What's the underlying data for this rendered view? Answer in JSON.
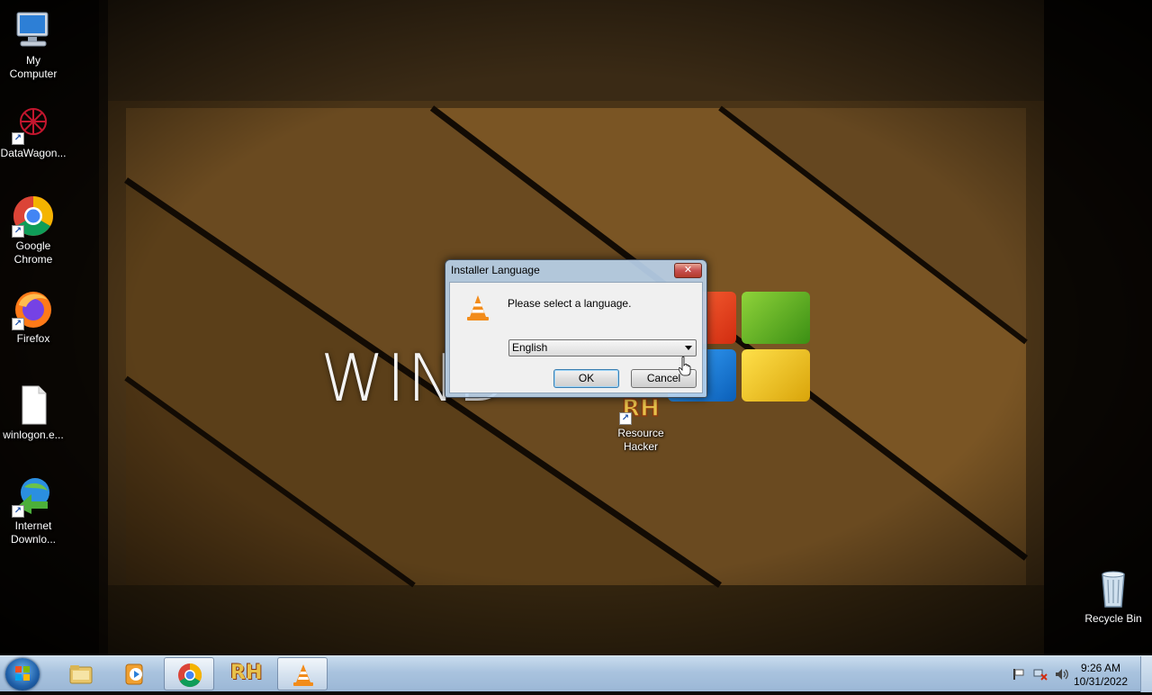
{
  "desktop": {
    "wallpaper_text": "WIND",
    "icons": [
      {
        "label": "My\nComputer",
        "name": "my-computer"
      },
      {
        "label": "DataWagon...",
        "name": "datawagon"
      },
      {
        "label": "Google\nChrome",
        "name": "google-chrome"
      },
      {
        "label": "Firefox",
        "name": "firefox"
      },
      {
        "label": "winlogon.e...",
        "name": "winlogon"
      },
      {
        "label": "Internet\nDownlo...",
        "name": "internet-download-manager"
      },
      {
        "label": "Resource\nHacker",
        "name": "resource-hacker"
      },
      {
        "label": "Recycle Bin",
        "name": "recycle-bin"
      }
    ]
  },
  "dialog": {
    "title": "Installer Language",
    "close_label": "✕",
    "message": "Please select a language.",
    "language_selected": "English",
    "ok_label": "OK",
    "cancel_label": "Cancel"
  },
  "taskbar": {
    "rh_label": "RH",
    "time": "9:26 AM",
    "date": "10/31/2022"
  },
  "colors": {
    "dialog_frame": "#b9d1ea",
    "taskbar": "#a9c3de",
    "accent": "#3c7fb1"
  }
}
